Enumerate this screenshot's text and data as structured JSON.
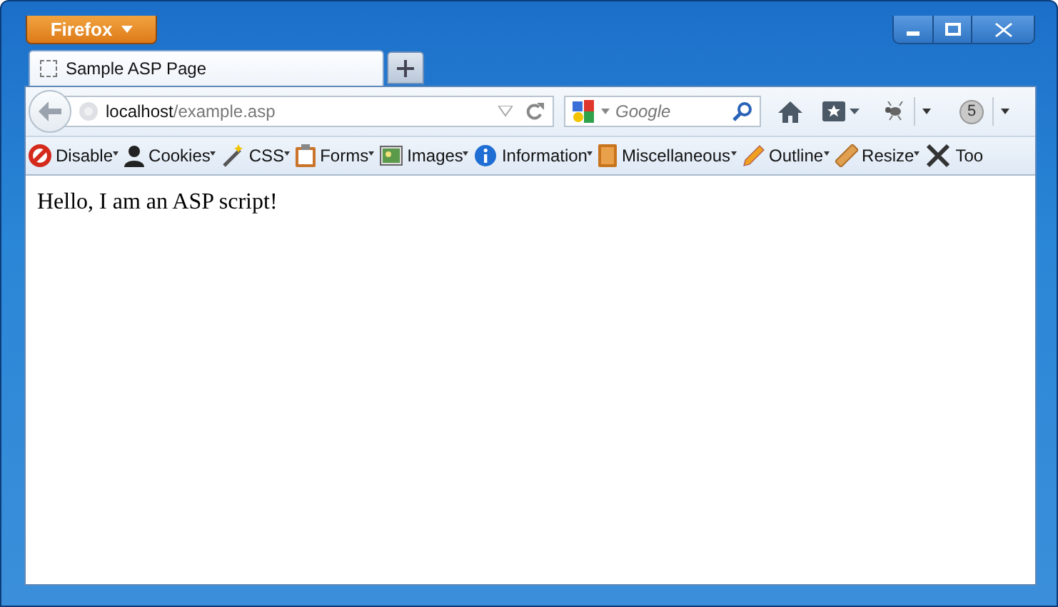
{
  "app_button": {
    "label": "Firefox"
  },
  "tabs": [
    {
      "title": "Sample ASP Page",
      "selected": true
    }
  ],
  "address_bar": {
    "host": "localhost",
    "path": "/example.asp"
  },
  "search": {
    "placeholder": "Google"
  },
  "nav_badge": "5",
  "web_developer_toolbar": [
    {
      "label": "Disable",
      "kind": "disable"
    },
    {
      "label": "Cookies",
      "kind": "cookies"
    },
    {
      "label": "CSS",
      "kind": "css"
    },
    {
      "label": "Forms",
      "kind": "forms"
    },
    {
      "label": "Images",
      "kind": "images"
    },
    {
      "label": "Information",
      "kind": "information"
    },
    {
      "label": "Miscellaneous",
      "kind": "miscellaneous"
    },
    {
      "label": "Outline",
      "kind": "outline"
    },
    {
      "label": "Resize",
      "kind": "resize"
    },
    {
      "label": "Too",
      "kind": "tools"
    }
  ],
  "page": {
    "text": "Hello, I am an ASP script!"
  }
}
